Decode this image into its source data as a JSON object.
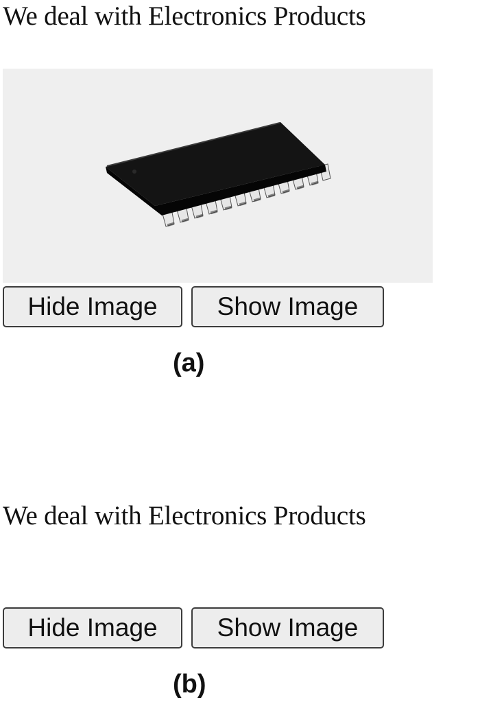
{
  "panel_a": {
    "heading": "We deal with Electronics Products",
    "image_visible": true,
    "buttons": {
      "hide_label": "Hide Image",
      "show_label": "Show Image"
    },
    "caption": "(a)"
  },
  "panel_b": {
    "heading": "We deal with Electronics Products",
    "image_visible": false,
    "buttons": {
      "hide_label": "Hide Image",
      "show_label": "Show Image"
    },
    "caption": "(b)"
  },
  "colors": {
    "image_background": "#efefef",
    "button_background": "#ededed",
    "button_border": "#3c3c3c",
    "chip_body": "#111111",
    "chip_pins": "#e8e8e8"
  },
  "icons": {
    "product_image": "ic-chip-image"
  }
}
